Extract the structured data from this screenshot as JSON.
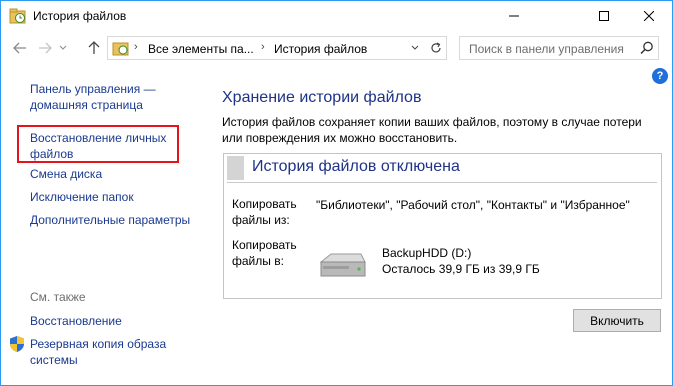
{
  "window": {
    "title": "История файлов"
  },
  "navigation": {
    "breadcrumb": [
      "Все элементы па...",
      "История файлов"
    ],
    "search_placeholder": "Поиск в панели управления"
  },
  "sidebar": {
    "home_link": "Панель управления — домашняя страница",
    "items": [
      "Восстановление личных файлов",
      "Смена диска",
      "Исключение папок",
      "Дополнительные параметры"
    ],
    "see_also_heading": "См. также",
    "see_also": [
      "Восстановление",
      "Резервная копия образа системы"
    ]
  },
  "main": {
    "title": "Хранение истории файлов",
    "description": "История файлов сохраняет копии ваших файлов, поэтому в случае потери или повреждения их можно восстановить.",
    "status_title": "История файлов отключена",
    "copy_from_label": "Копировать файлы из:",
    "copy_from_value": "\"Библиотеки\", \"Рабочий стол\", \"Контакты\" и \"Избранное\"",
    "copy_to_label": "Копировать файлы в:",
    "drive_name": "BackupHDD (D:)",
    "drive_free": "Осталось 39,9 ГБ из 39,9 ГБ",
    "enable_button": "Включить"
  },
  "icons": {
    "app": "file-history-icon",
    "help": "help-icon",
    "drive": "hard-drive-icon",
    "shield": "uac-shield-icon"
  },
  "colors": {
    "link": "#1a3a8f",
    "heading": "#1e3287",
    "highlight": "#e3151a",
    "window_border": "#2b9af3"
  }
}
